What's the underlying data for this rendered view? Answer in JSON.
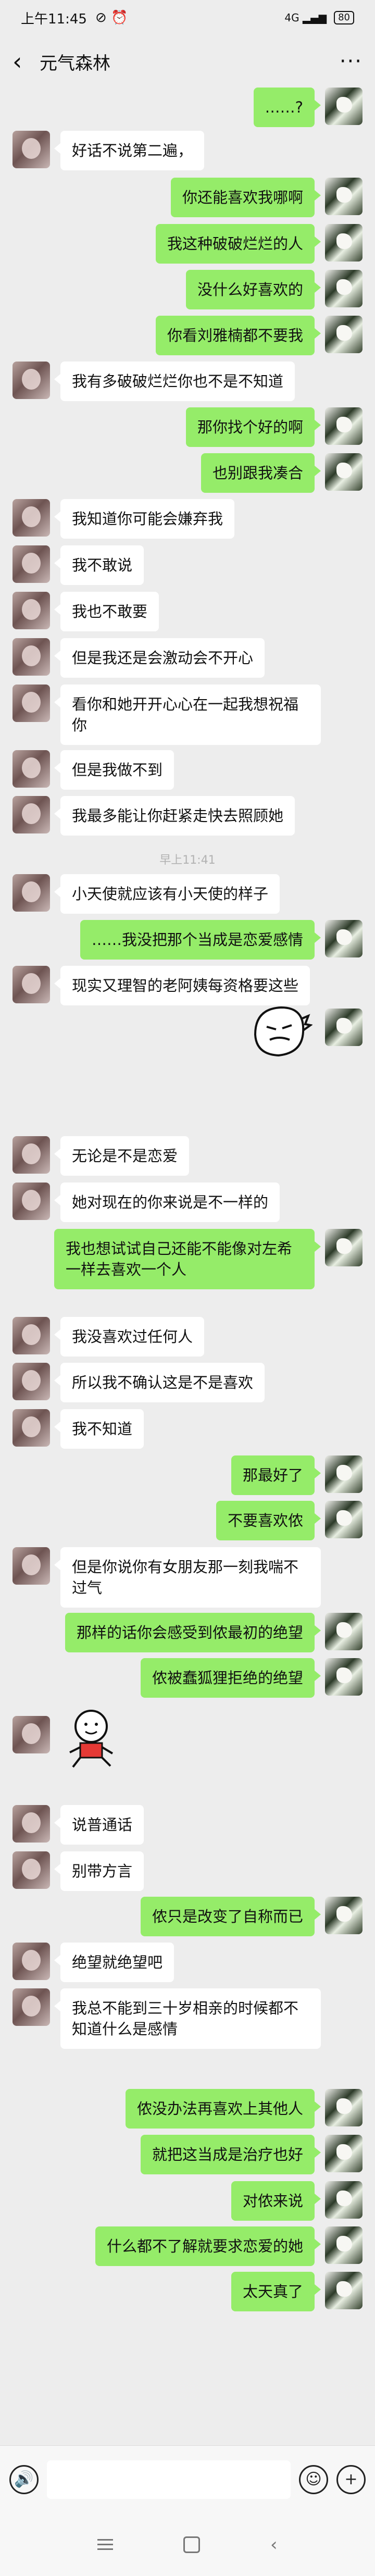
{
  "status": {
    "time": "上午11:45",
    "indicators": "⊘ ⏰",
    "signal": "4G ▂▄▆",
    "battery": "80"
  },
  "header": {
    "back_icon": "‹",
    "title": "元气森林",
    "more_icon": "···"
  },
  "messages": [
    {
      "side": "right",
      "text": "……?"
    },
    {
      "side": "left",
      "text": "好话不说第二遍，"
    },
    {
      "side": "right",
      "text": "你还能喜欢我哪啊"
    },
    {
      "side": "right",
      "text": "我这种破破烂烂的人"
    },
    {
      "side": "right",
      "text": "没什么好喜欢的"
    },
    {
      "side": "right",
      "text": "你看刘雅楠都不要我"
    },
    {
      "side": "left",
      "text": "我有多破破烂烂你也不是不知道"
    },
    {
      "side": "right",
      "text": "那你找个好的啊"
    },
    {
      "side": "right",
      "text": "也别跟我凑合"
    },
    {
      "side": "left",
      "text": "我知道你可能会嫌弃我"
    },
    {
      "side": "left",
      "text": "我不敢说"
    },
    {
      "side": "left",
      "text": "我也不敢要"
    },
    {
      "side": "left",
      "text": "但是我还是会激动会不开心"
    },
    {
      "side": "left",
      "text": "看你和她开开心心在一起我想祝福你"
    },
    {
      "side": "left",
      "text": "但是我做不到"
    },
    {
      "side": "left",
      "text": "我最多能让你赶紧走快去照顾她"
    },
    {
      "side": "time",
      "text": "早上11:41"
    },
    {
      "side": "left",
      "text": "小天使就应该有小天使的样子"
    },
    {
      "side": "right",
      "text": "……我没把那个当成是恋爱感情"
    },
    {
      "side": "left",
      "text": "现实又理智的老阿姨每资格要这些"
    },
    {
      "side": "sticker-right",
      "text": ""
    },
    {
      "side": "left",
      "text": "无论是不是恋爱"
    },
    {
      "side": "left",
      "text": "她对现在的你来说是不一样的"
    },
    {
      "side": "right",
      "text": "我也想试试自己还能不能像对左希一样去喜欢一个人"
    },
    {
      "side": "left",
      "text": "我没喜欢过任何人"
    },
    {
      "side": "left",
      "text": "所以我不确认这是不是喜欢"
    },
    {
      "side": "left",
      "text": "我不知道"
    },
    {
      "side": "right",
      "text": "那最好了"
    },
    {
      "side": "right",
      "text": "不要喜欢侬"
    },
    {
      "side": "left",
      "text": "但是你说你有女朋友那一刻我喘不过气"
    },
    {
      "side": "right",
      "text": "那样的话你会感受到侬最初的绝望"
    },
    {
      "side": "right",
      "text": "侬被蠢狐狸拒绝的绝望"
    },
    {
      "side": "sticker-left",
      "text": ""
    },
    {
      "side": "left",
      "text": "说普通话"
    },
    {
      "side": "left",
      "text": "别带方言"
    },
    {
      "side": "right",
      "text": "侬只是改变了自称而已"
    },
    {
      "side": "left",
      "text": "绝望就绝望吧"
    },
    {
      "side": "left",
      "text": "我总不能到三十岁相亲的时候都不知道什么是感情"
    },
    {
      "side": "right",
      "text": "侬没办法再喜欢上其他人"
    },
    {
      "side": "right",
      "text": "就把这当成是治疗也好"
    },
    {
      "side": "right",
      "text": "对侬来说"
    },
    {
      "side": "right",
      "text": "什么都不了解就要求恋爱的她"
    },
    {
      "side": "right",
      "text": "太天真了"
    }
  ],
  "input": {
    "voice_icon": "🔊",
    "placeholder": "",
    "emoji_icon": "☺",
    "plus_icon": "+"
  },
  "nav": {
    "back_icon": "‹"
  },
  "colors": {
    "background": "#ededed",
    "bubble_self": "#95ec69",
    "bubble_other": "#ffffff"
  }
}
